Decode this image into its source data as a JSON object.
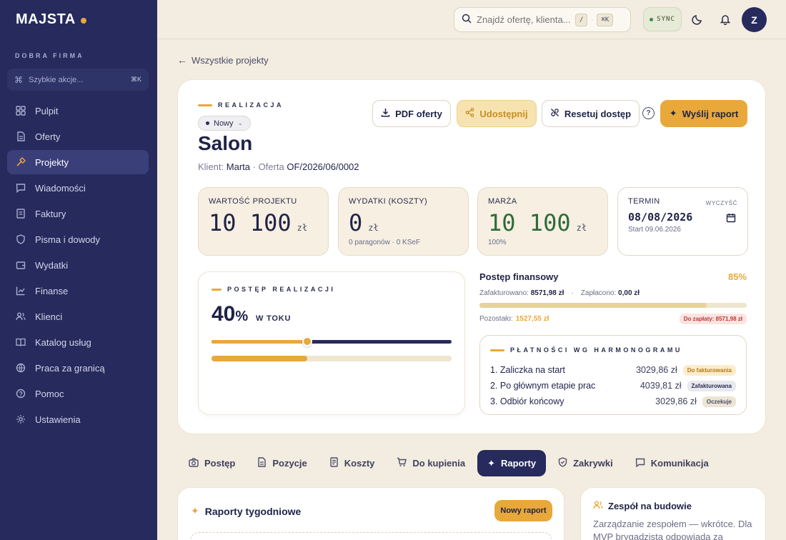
{
  "sidebar": {
    "brand": "MAJSTA",
    "org": "DOBRA FIRMA",
    "quick_placeholder": "Szybkie akcje...",
    "quick_kbd": "⌘K",
    "items": [
      {
        "label": "Pulpit",
        "icon": "grid-icon"
      },
      {
        "label": "Oferty",
        "icon": "document-icon"
      },
      {
        "label": "Projekty",
        "icon": "hammer-icon"
      },
      {
        "label": "Wiadomości",
        "icon": "message-icon"
      },
      {
        "label": "Faktury",
        "icon": "invoice-icon"
      },
      {
        "label": "Pisma i dowody",
        "icon": "shield-icon"
      },
      {
        "label": "Wydatki",
        "icon": "wallet-icon"
      },
      {
        "label": "Finanse",
        "icon": "chart-icon"
      },
      {
        "label": "Klienci",
        "icon": "users-icon"
      },
      {
        "label": "Katalog usług",
        "icon": "book-icon"
      },
      {
        "label": "Praca za granicą",
        "icon": "globe-icon"
      },
      {
        "label": "Pomoc",
        "icon": "help-icon"
      },
      {
        "label": "Ustawienia",
        "icon": "gear-icon"
      }
    ],
    "active_item": "Projekty"
  },
  "topbar": {
    "search_placeholder": "Znajdź ofertę, klienta...",
    "kbd_slash": "/",
    "kbd_sep": "·",
    "kbd_cmd": "⌘K",
    "sync_label": "SYNC",
    "avatar_initial": "Z"
  },
  "back_link": "Wszystkie projekty",
  "project": {
    "eyebrow": "REALIZACJA",
    "status": "Nowy",
    "title": "Salon",
    "client_label": "Klient:",
    "client_name": "Marta",
    "offer_label": "· Oferta",
    "offer_no": "OF/2026/06/0002"
  },
  "actions": {
    "pdf": "PDF oferty",
    "share": "Udostępnij",
    "reset": "Resetuj dostęp",
    "help": "?",
    "send": "Wyślij raport"
  },
  "stats": {
    "value": {
      "label": "WARTOŚĆ PROJEKTU",
      "amount": "10 100",
      "currency": "zł"
    },
    "costs": {
      "label": "WYDATKI (KOSZTY)",
      "amount": "0",
      "currency": "zł",
      "sub": "0 paragonów · 0 KSeF"
    },
    "margin": {
      "label": "MARŻA",
      "amount": "10 100",
      "currency": "zł",
      "sub": "100%"
    },
    "term": {
      "label": "TERMIN",
      "clear": "WYCZYŚĆ",
      "date": "08/08/2026",
      "start": "Start 09.06.2026"
    }
  },
  "progress": {
    "eyebrow": "POSTĘP REALIZACJI",
    "percent": "40",
    "percent_sign": "%",
    "state": "W TOKU",
    "value": 0.4
  },
  "finance": {
    "title": "Postęp finansowy",
    "percent": "85%",
    "invoiced_label": "Zafakturowano:",
    "invoiced": "8571,98 zł",
    "dot": "·",
    "paid_label": "Zapłacono:",
    "paid": "0,00 zł",
    "fill": 0.85,
    "remaining_label": "Pozostało:",
    "remaining": "1527,55 zł",
    "due": "Do zapłaty: 8571,98 zł"
  },
  "schedule": {
    "eyebrow": "PŁATNOŚCI WG HARMONOGRAMU",
    "rows": [
      {
        "name": "1. Zaliczka na start",
        "amount": "3029,86 zł",
        "badge": "Do fakturowania",
        "badge_bg": "#fbeccb",
        "badge_fg": "#b57a14"
      },
      {
        "name": "2. Po głównym etapie prac",
        "amount": "4039,81 zł",
        "badge": "Zafakturowana",
        "badge_bg": "#e8e8ee",
        "badge_fg": "#2a2d4f"
      },
      {
        "name": "3. Odbiór końcowy",
        "amount": "3029,86 zł",
        "badge": "Oczekuje",
        "badge_bg": "#ece4d4",
        "badge_fg": "#4b4e6a"
      }
    ]
  },
  "tabs": [
    {
      "label": "Postęp",
      "icon": "camera-icon"
    },
    {
      "label": "Pozycje",
      "icon": "document-icon"
    },
    {
      "label": "Koszty",
      "icon": "receipt-icon"
    },
    {
      "label": "Do kupienia",
      "icon": "cart-icon"
    },
    {
      "label": "Raporty",
      "icon": "sparkle-icon"
    },
    {
      "label": "Zakrywki",
      "icon": "shield-check-icon"
    },
    {
      "label": "Komunikacja",
      "icon": "message-icon"
    }
  ],
  "active_tab": "Raporty",
  "reports": {
    "title": "Raporty tygodniowe",
    "new_button": "Nowy raport"
  },
  "team": {
    "title": "Zespół na budowie",
    "text": "Zarządzanie zespołem — wkrótce. Dla MVP brygadzista odpowiada za zlecenie."
  }
}
